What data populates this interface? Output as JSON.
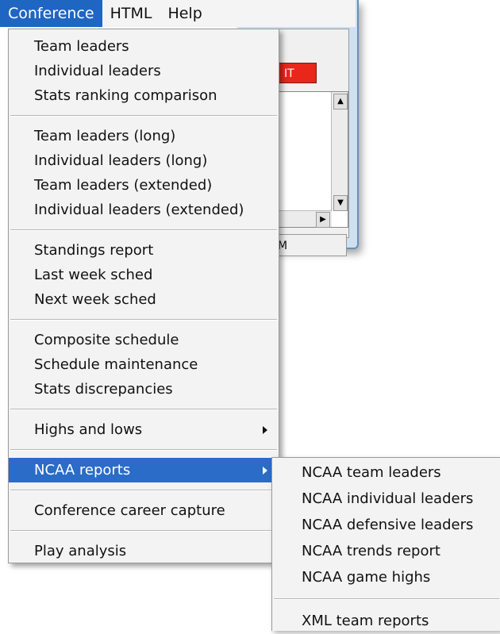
{
  "menubar": {
    "items": [
      {
        "label": "Conference",
        "active": true
      },
      {
        "label": "HTML",
        "active": false
      },
      {
        "label": "Help",
        "active": false
      }
    ]
  },
  "background_window": {
    "red_button_label": "IT",
    "status_text": "M",
    "colors": {
      "button": "#e8261a",
      "frame": "#cfe0f0"
    }
  },
  "conference_menu": {
    "groups": [
      [
        "Team leaders",
        "Individual leaders",
        "Stats ranking comparison"
      ],
      [
        "Team leaders (long)",
        "Individual leaders (long)",
        "Team leaders (extended)",
        "Individual leaders (extended)"
      ],
      [
        "Standings report",
        "Last week sched",
        "Next week sched"
      ],
      [
        "Composite schedule",
        "Schedule maintenance",
        "Stats discrepancies"
      ],
      [
        "Highs and lows"
      ],
      [
        "NCAA reports"
      ],
      [
        "Conference career capture"
      ],
      [
        "Play analysis"
      ]
    ],
    "highlight_color": "#2a6cc7"
  },
  "ncaa_submenu": {
    "groups": [
      [
        "NCAA team leaders",
        "NCAA individual leaders",
        "NCAA defensive leaders",
        "NCAA trends report",
        "NCAA game highs"
      ],
      [
        "XML team reports"
      ]
    ]
  }
}
